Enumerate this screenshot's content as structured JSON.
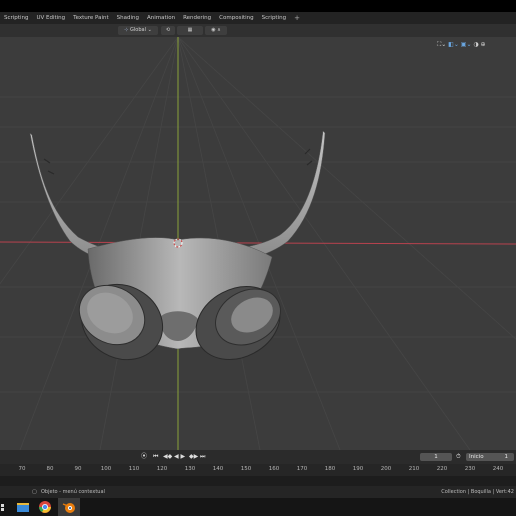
{
  "workspace_tabs": [
    "Scripting",
    "UV Editing",
    "Texture Paint",
    "Shading",
    "Animation",
    "Rendering",
    "Compositing",
    "Scripting",
    "+"
  ],
  "header": {
    "transform_orientation": "Global",
    "dropdown_glyph": "⌄"
  },
  "timeline": {
    "current_frame": "1",
    "start_label": "Inicio",
    "start_value": "1",
    "ruler_ticks": [
      "70",
      "80",
      "90",
      "100",
      "110",
      "120",
      "130",
      "140",
      "150",
      "160",
      "170",
      "180",
      "190",
      "200",
      "210",
      "220",
      "230",
      "240"
    ]
  },
  "status_bar": {
    "left_text": "Objeto - menú contextual",
    "right_text": "Collection | Boquilla | Vert:42"
  },
  "icons": [
    "gizmo-icons",
    "jump-start-icon",
    "play-icon",
    "clock-icon",
    "file-explorer-icon",
    "chrome-icon",
    "blender-icon"
  ],
  "colors": {
    "viewport": "#3c3c3c",
    "x_axis": "#b8424e",
    "y_axis": "#8aa23a"
  }
}
